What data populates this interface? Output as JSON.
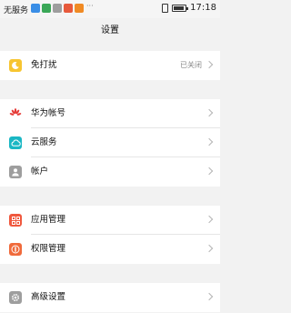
{
  "status_bar": {
    "carrier": "无服务",
    "notification_icon_colors": [
      "#3a8ee6",
      "#3aa757",
      "#9e9e9e",
      "#e75a3c",
      "#f08a24"
    ],
    "more": "···",
    "time": "17:18"
  },
  "header": {
    "title": "设置"
  },
  "groups": [
    [
      {
        "label": "免打扰",
        "value": "已关闭",
        "icon": "moon-icon",
        "color": "#f7c531"
      }
    ],
    [
      {
        "label": "华为帐号",
        "icon": "huawei-logo-icon",
        "color": "#e53935"
      },
      {
        "label": "云服务",
        "icon": "cloud-icon",
        "color": "#1ab7c4"
      },
      {
        "label": "帐户",
        "icon": "account-icon",
        "color": "#9e9e9e"
      }
    ],
    [
      {
        "label": "应用管理",
        "icon": "apps-icon",
        "color": "#f0583e"
      },
      {
        "label": "权限管理",
        "icon": "permission-icon",
        "color": "#f06a3b"
      }
    ],
    [
      {
        "label": "高级设置",
        "icon": "gear-icon",
        "color": "#9e9e9e"
      }
    ]
  ]
}
